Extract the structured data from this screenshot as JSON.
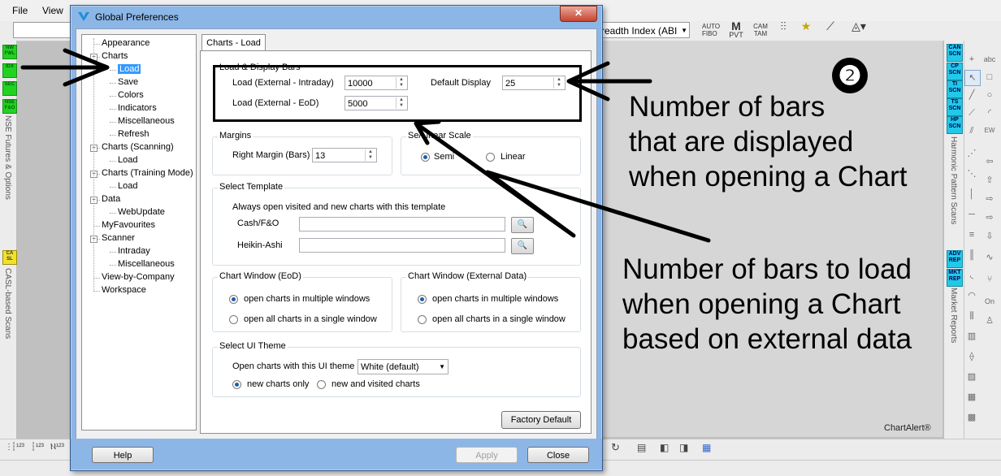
{
  "menu": {
    "file": "File",
    "view": "View"
  },
  "app_toolbar": {
    "indicator_combo": "readth Index (ABI",
    "buttons": [
      "AUTO FIBO",
      "PVT",
      "CAM TAM",
      "TRN",
      "SL",
      "FIB"
    ]
  },
  "left_strip": {
    "chips": [
      "NW FWL",
      "IDX",
      "SEC",
      "NSE F&O"
    ],
    "vertical_labels": [
      "NSE Futures & Options",
      "CASL-based Scans"
    ],
    "casl_chip": "CA SL"
  },
  "right_strip": {
    "chips_top": [
      "CAN SCN",
      "CP SCN",
      "TI SCN",
      "TS SCN",
      "HP SCN"
    ],
    "chips_bottom": [
      "ADV REP",
      "MKT REP"
    ],
    "vertical_labels": [
      "Harmonic Pattern Scans",
      "Market Reports"
    ]
  },
  "dialog": {
    "title": "Global Preferences",
    "close_glyph": "✕",
    "tree": [
      {
        "label": "Appearance",
        "level": 0
      },
      {
        "label": "Charts",
        "level": 0,
        "expander": "−"
      },
      {
        "label": "Load",
        "level": 1,
        "selected": true
      },
      {
        "label": "Save",
        "level": 1
      },
      {
        "label": "Colors",
        "level": 1
      },
      {
        "label": "Indicators",
        "level": 1
      },
      {
        "label": "Miscellaneous",
        "level": 1
      },
      {
        "label": "Refresh",
        "level": 1
      },
      {
        "label": "Charts (Scanning)",
        "level": 0,
        "expander": "−"
      },
      {
        "label": "Load",
        "level": 1
      },
      {
        "label": "Charts (Training Mode)",
        "level": 0,
        "expander": "−"
      },
      {
        "label": "Load",
        "level": 1
      },
      {
        "label": "Data",
        "level": 0,
        "expander": "−"
      },
      {
        "label": "WebUpdate",
        "level": 1
      },
      {
        "label": "MyFavourites",
        "level": 0
      },
      {
        "label": "Scanner",
        "level": 0,
        "expander": "−"
      },
      {
        "label": "Intraday",
        "level": 1
      },
      {
        "label": "Miscellaneous",
        "level": 1
      },
      {
        "label": "View-by-Company",
        "level": 0
      },
      {
        "label": "Workspace",
        "level": 0
      }
    ],
    "tab": "Charts - Load",
    "load_display": {
      "title": "Load & Display Bars",
      "intraday_label": "Load (External - Intraday)",
      "intraday_value": "10000",
      "eod_label": "Load (External - EoD)",
      "eod_value": "5000",
      "default_display_label": "Default Display",
      "default_display_value": "25"
    },
    "margins": {
      "title": "Margins",
      "right_margin_label": "Right Margin (Bars)",
      "right_margin_value": "13"
    },
    "scale": {
      "title": "Se",
      "title_tail": "/Linear Scale",
      "semi_label": "Semi",
      "linear_label": "Linear",
      "selected": "semi"
    },
    "template": {
      "title": "Select Template",
      "description": "Always open visited and new charts with this template",
      "cash_label": "Cash/F&O",
      "cash_value": "",
      "heikin_label": "Heikin-Ashi",
      "heikin_value": ""
    },
    "chart_window_eod": {
      "title": "Chart Window (EoD)",
      "option1": "open charts in multiple windows",
      "option2": "open all charts in a single window",
      "selected": 1
    },
    "chart_window_ext": {
      "title": "Chart Window (External Data)",
      "option1": "open charts in multiple windows",
      "option2": "open all charts in a single window",
      "selected": 1
    },
    "ui_theme": {
      "title": "Select UI Theme",
      "label": "Open charts with this UI theme",
      "value": "White (default)",
      "option_new": "new charts only",
      "option_all": "new and visited charts",
      "selected": "new"
    },
    "factory_default": "Factory Default",
    "help": "Help",
    "apply": "Apply",
    "close": "Close"
  },
  "annotations": {
    "badge": "❷",
    "text1_lines": [
      "Number of bars",
      "that are displayed",
      "when opening a Chart"
    ],
    "text2_lines": [
      "Number of bars to load",
      "when opening a Chart",
      "based on external data"
    ]
  },
  "watermark": "ChartAlert®"
}
